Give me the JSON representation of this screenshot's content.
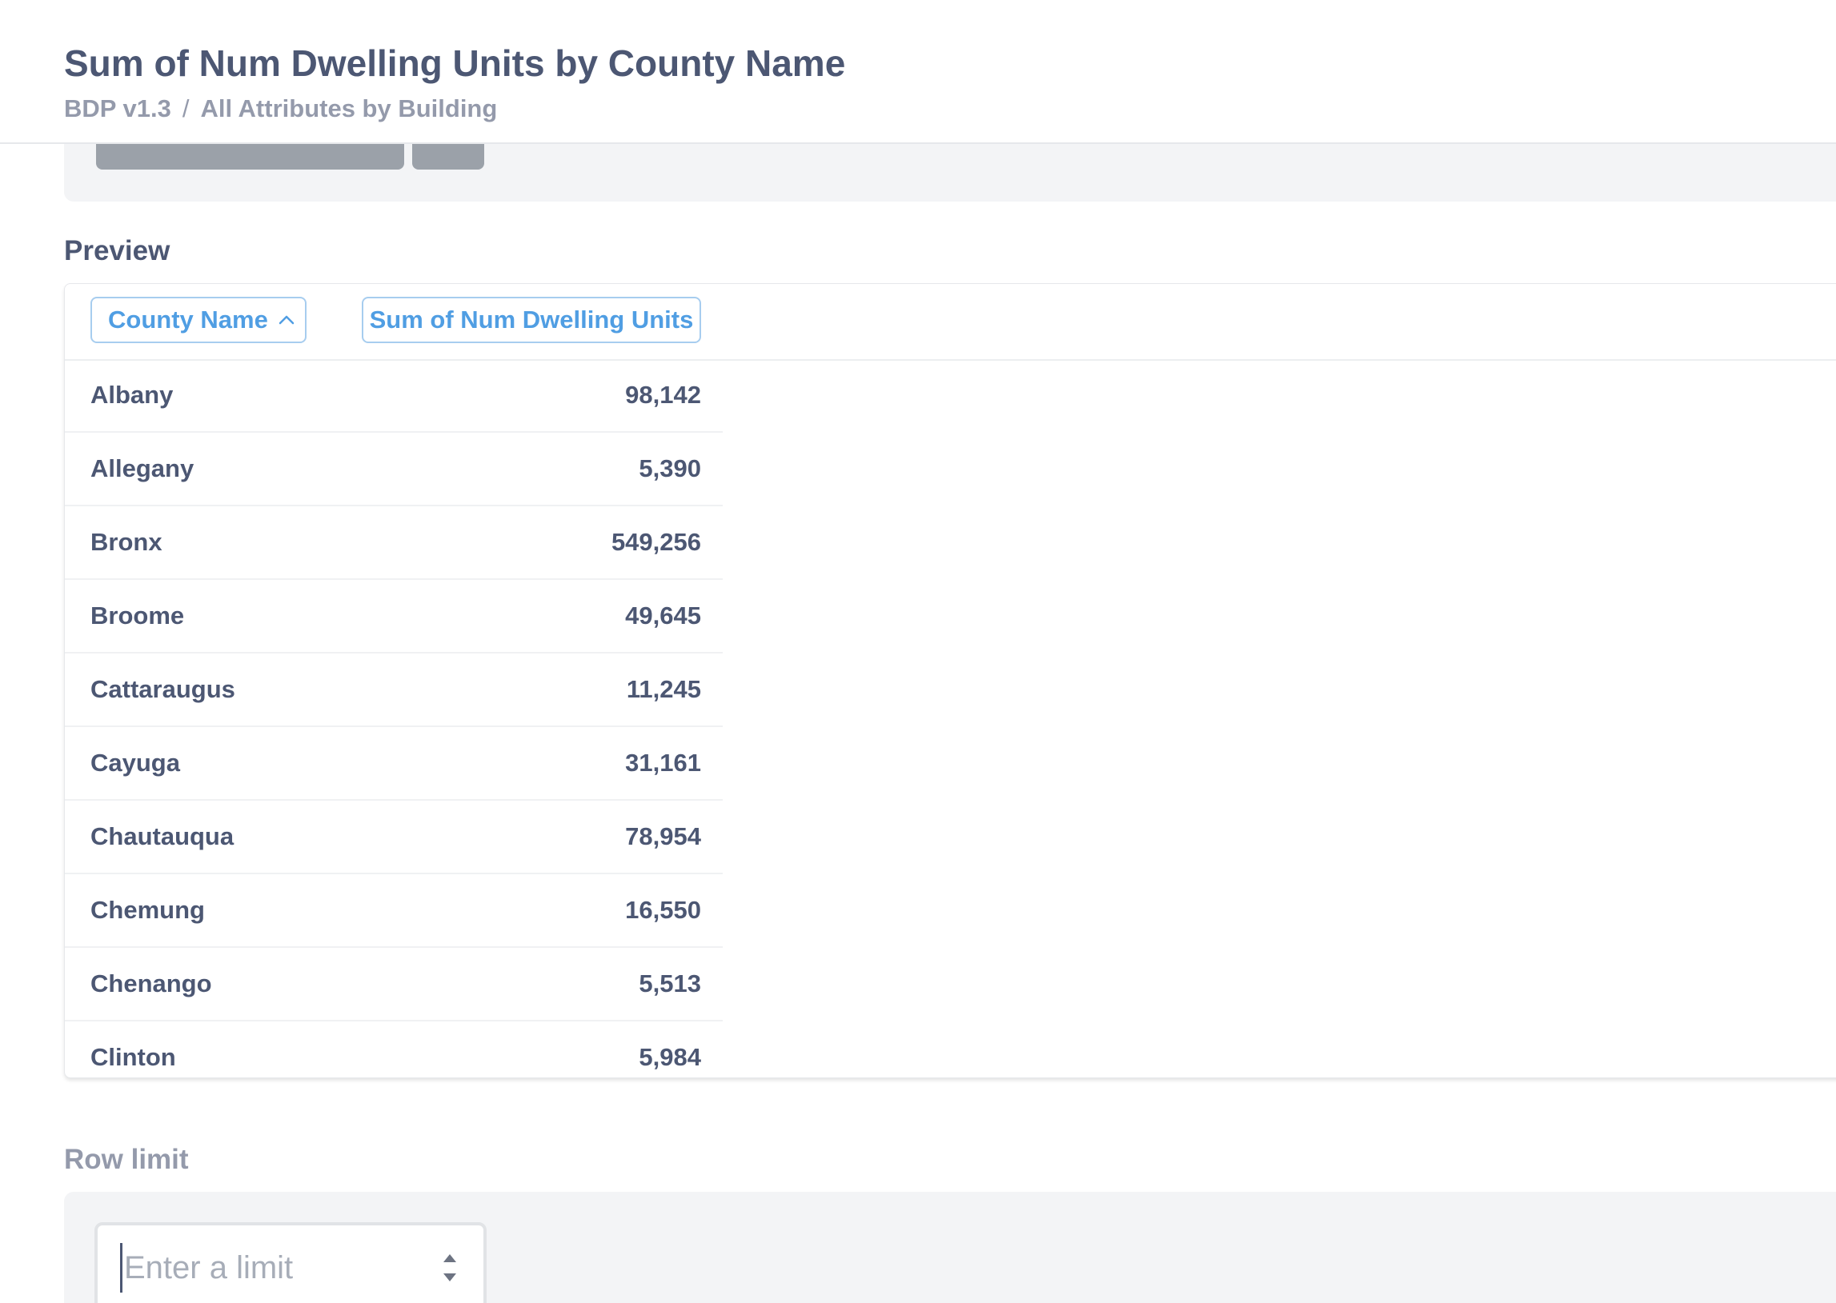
{
  "header": {
    "title": "Sum of Num Dwelling Units by County Name",
    "breadcrumb": {
      "source": "BDP v1.3",
      "separator": "/",
      "table": "All Attributes by Building"
    }
  },
  "preview": {
    "label": "Preview",
    "columns": [
      {
        "label": "County Name",
        "sort": "ascending"
      },
      {
        "label": "Sum of Num Dwelling Units"
      }
    ],
    "rows": [
      {
        "name": "Albany",
        "value": "98,142"
      },
      {
        "name": "Allegany",
        "value": "5,390"
      },
      {
        "name": "Bronx",
        "value": "549,256"
      },
      {
        "name": "Broome",
        "value": "49,645"
      },
      {
        "name": "Cattaraugus",
        "value": "11,245"
      },
      {
        "name": "Cayuga",
        "value": "31,161"
      },
      {
        "name": "Chautauqua",
        "value": "78,954"
      },
      {
        "name": "Chemung",
        "value": "16,550"
      },
      {
        "name": "Chenango",
        "value": "5,513"
      },
      {
        "name": "Clinton",
        "value": "5,984"
      }
    ]
  },
  "row_limit": {
    "label": "Row limit",
    "input_value": "",
    "placeholder": "Enter a limit"
  },
  "colors": {
    "accent": "#509ee3",
    "text": "#4c5773",
    "muted": "#949aab",
    "panel_bg": "#f3f4f6"
  },
  "icons": {
    "sort": "chevron-up-icon",
    "stepper": "stepper-icon"
  }
}
